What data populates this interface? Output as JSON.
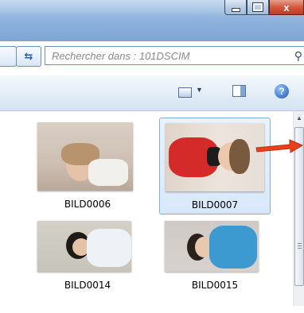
{
  "window": {
    "caption_buttons": [
      {
        "name": "minimize",
        "icon": "minimize-icon"
      },
      {
        "name": "maximize",
        "icon": "maximize-icon"
      },
      {
        "name": "close",
        "icon": "close-icon",
        "label": "x"
      }
    ]
  },
  "search": {
    "placeholder": "Rechercher dans : 101DSCIM",
    "icon": "search-icon"
  },
  "toolbar": {
    "refresh_icon": "refresh-icon",
    "view_icon": "change-view-icon",
    "view_dropdown_glyph": "▼",
    "preview_icon": "preview-pane-icon",
    "help_label": "?"
  },
  "files": [
    {
      "name": "BILD0006",
      "selected": false
    },
    {
      "name": "BILD0007",
      "selected": true
    },
    {
      "name": "BILD0014",
      "selected": false
    },
    {
      "name": "BILD0015",
      "selected": false
    }
  ],
  "colors": {
    "selection": "#d8e8fb",
    "selection_border": "#84acdd",
    "annotation_arrow": "#e8401c",
    "title_bar": "#8fb3dc"
  }
}
